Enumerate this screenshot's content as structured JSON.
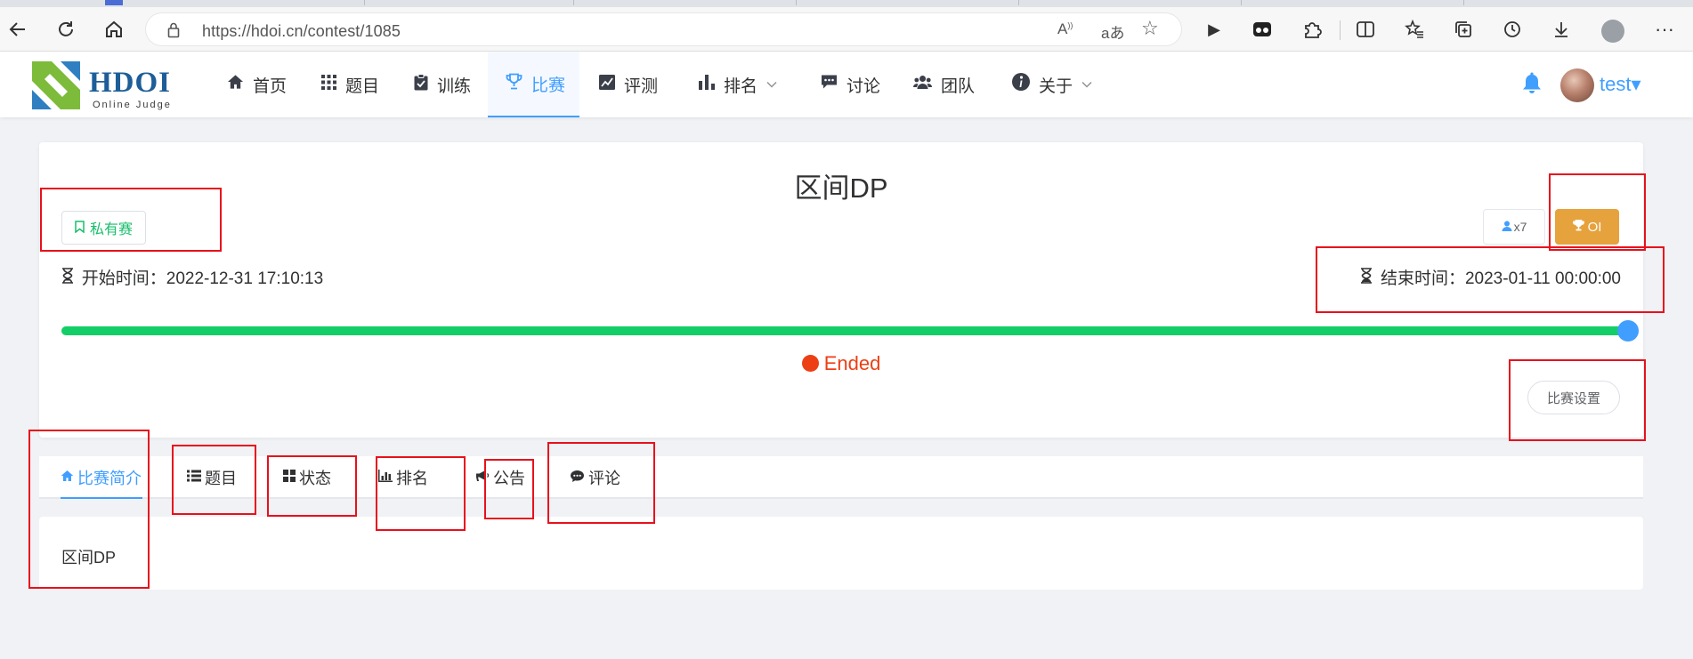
{
  "browser": {
    "url": "https://hdoi.cn/contest/1085",
    "icons": [
      "back-icon",
      "refresh-icon",
      "home-icon",
      "lock-icon",
      "read-aloud-icon",
      "translate-icon",
      "favorite-star-icon",
      "play-icon",
      "extension-icon",
      "puzzle-icon",
      "split-screen-icon",
      "favorites-icon",
      "collections-icon",
      "history-icon",
      "download-icon",
      "profile-icon",
      "more-icon"
    ]
  },
  "site": {
    "logo": {
      "brand": "HDOI",
      "tagline": "Online Judge",
      "colors": [
        "#7dbb3a",
        "#2f7fc1"
      ]
    },
    "nav": [
      {
        "label": "首页",
        "icon": "home-icon"
      },
      {
        "label": "题目",
        "icon": "grid-icon"
      },
      {
        "label": "训练",
        "icon": "clipboard-check-icon"
      },
      {
        "label": "比赛",
        "icon": "trophy-icon",
        "active": true
      },
      {
        "label": "评测",
        "icon": "line-chart-icon"
      },
      {
        "label": "排名",
        "icon": "bar-chart-icon",
        "dropdown": true
      },
      {
        "label": "讨论",
        "icon": "comment-icon"
      },
      {
        "label": "团队",
        "icon": "users-icon"
      },
      {
        "label": "关于",
        "icon": "info-icon",
        "dropdown": true
      }
    ],
    "user": {
      "name": "test",
      "dropdown_glyph": "▾"
    },
    "accent": "#409eff"
  },
  "contest": {
    "title": "区间DP",
    "visibility": "私有赛",
    "participants": "x7",
    "rule_type": "OI",
    "start_label": "开始时间：",
    "start_time": "2022-12-31 17:10:13",
    "end_label": "结束时间：",
    "end_time": "2023-01-11 00:00:00",
    "progress": 1.0,
    "status": "Ended",
    "settings_button": "比赛设置",
    "colors": {
      "private": "#19be6b",
      "oi": "#e6a23c",
      "progress": "#13ce66",
      "ended": "#ed3f14"
    }
  },
  "tabs": [
    {
      "label": "比赛简介",
      "icon": "home-icon",
      "active": true
    },
    {
      "label": "题目",
      "icon": "list-icon"
    },
    {
      "label": "状态",
      "icon": "grid-icon"
    },
    {
      "label": "排名",
      "icon": "bar-chart-icon"
    },
    {
      "label": "公告",
      "icon": "megaphone-icon"
    },
    {
      "label": "评论",
      "icon": "comment-icon"
    }
  ],
  "content": {
    "text": "区间DP"
  },
  "annotation_color": "#e8101c"
}
